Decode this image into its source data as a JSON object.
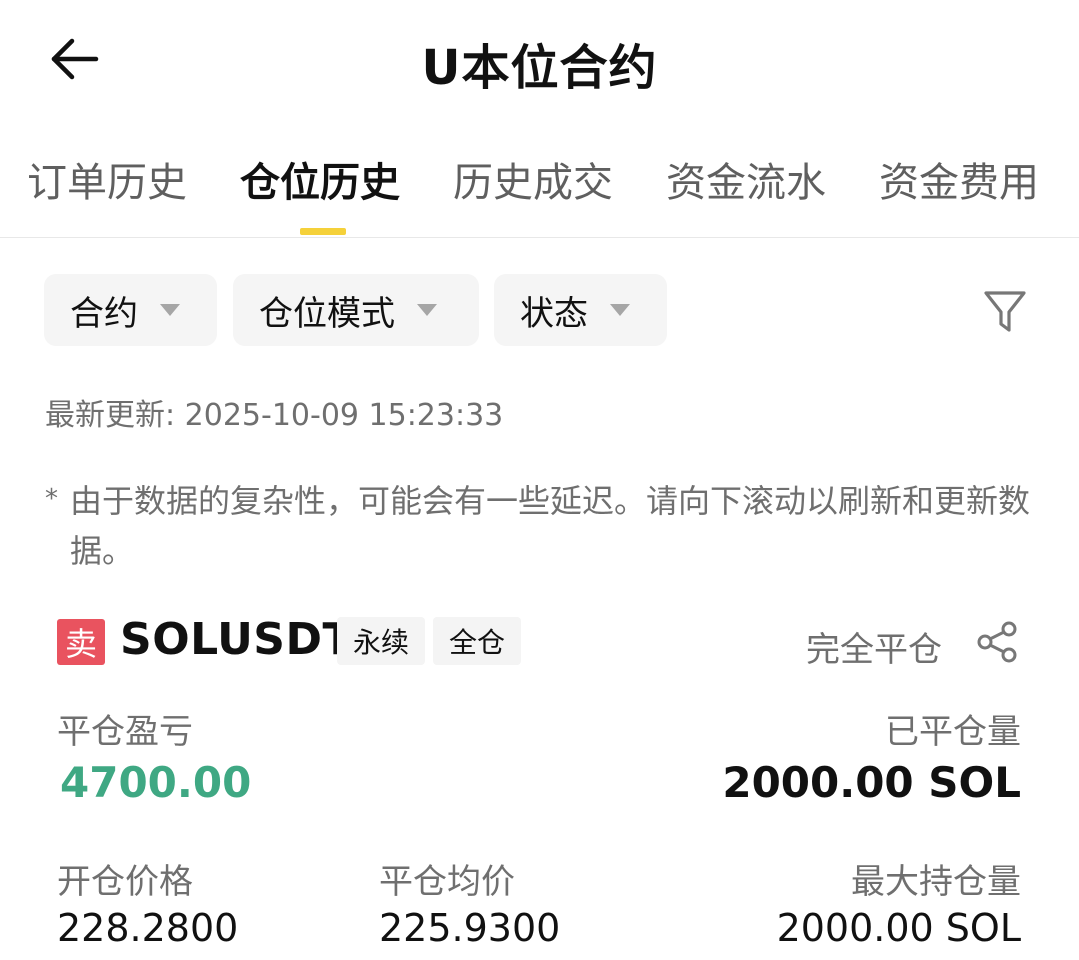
{
  "header": {
    "title": "U本位合约",
    "back_icon": "arrow-left-icon"
  },
  "tabs": [
    {
      "label": "订单历史",
      "active": false
    },
    {
      "label": "仓位历史",
      "active": true
    },
    {
      "label": "历史成交",
      "active": false
    },
    {
      "label": "资金流水",
      "active": false
    },
    {
      "label": "资金费用",
      "active": false
    }
  ],
  "filters": {
    "contract": "合约",
    "position_mode": "仓位模式",
    "status": "状态",
    "filter_icon": "funnel-icon"
  },
  "updated": "最新更新: 2025-10-09 15:23:33",
  "notice": {
    "star": "*",
    "text": "由于数据的复杂性，可能会有一些延迟。请向下滚动以刷新和更新数据。"
  },
  "position": {
    "side": "卖",
    "symbol": "SOLUSDT",
    "tags": [
      "永续",
      "全仓"
    ],
    "status": "完全平仓",
    "share_icon": "share-icon",
    "pnl_label": "平仓盈亏",
    "pnl_value": "4700.00",
    "closed_qty_label": "已平仓量",
    "closed_qty_value": "2000.00 SOL",
    "open_price_label": "开仓价格",
    "open_price_value": "228.2800",
    "close_avg_label": "平仓均价",
    "close_avg_value": "225.9300",
    "max_hold_label": "最大持仓量",
    "max_hold_value": "2000.00 SOL"
  },
  "colors": {
    "accent_yellow": "#f5d13a",
    "sell_red": "#e9535f",
    "profit_green": "#3fa883",
    "muted_text": "#6f6f6f"
  }
}
